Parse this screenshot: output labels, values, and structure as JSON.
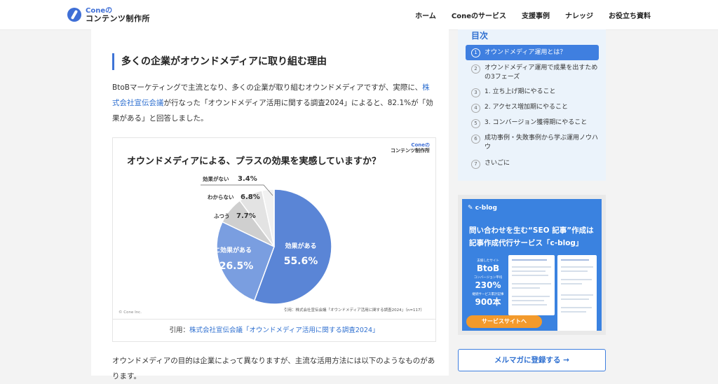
{
  "header": {
    "logo_top": "Coneの",
    "logo_bottom": "コンテンツ制作所",
    "nav": [
      "ホーム",
      "Coneのサービス",
      "支援事例",
      "ナレッジ",
      "お役立ち資料"
    ]
  },
  "article": {
    "heading": "多くの企業がオウンドメディアに取り組む理由",
    "intro_1": "BtoBマーケティングで主流となり、多くの企業が取り組むオウンドメディアですが、実際に、",
    "intro_link": "株式会社宣伝会議",
    "intro_2": "が行なった「オウンドメディア活用に関する調査2024」によると、82.1%が「効果がある」と回答しました。",
    "figure": {
      "logo_top": "Coneの",
      "logo_bottom": "コンテンツ制作所",
      "source": "引用：株式会社宣伝会議「オウンドメディア活用に関する調査2024」（n=117）",
      "copyright": "© Cone Inc."
    },
    "caption_prefix": "引用：",
    "caption_link": "株式会社宣伝会議「オウンドメディア活用に関する調査2024」",
    "outro": "オウンドメディアの目的は企業によって異なりますが、主流な活用方法には以下のようなものがあります。"
  },
  "chart_data": {
    "type": "pie",
    "title": "オウンドメディアによる、プラスの効果を実感していますか？",
    "slices": [
      {
        "label": "効果がある",
        "value": 55.6,
        "display": "55.6%",
        "color": "#5a85d6"
      },
      {
        "label": "非常に効果がある",
        "value": 26.5,
        "display": "26.5%",
        "color": "#7a9ee0"
      },
      {
        "label": "ふつう",
        "value": 7.7,
        "display": "7.7%",
        "color": "#cfcfcf"
      },
      {
        "label": "わからない",
        "value": 6.8,
        "display": "6.8%",
        "color": "#e3e3e3"
      },
      {
        "label": "効果がない",
        "value": 3.4,
        "display": "3.4%",
        "color": "#f1f1f1"
      }
    ]
  },
  "toc": {
    "title": "目次",
    "items": [
      {
        "num": "1",
        "text": "オウンドメディア運用とは？"
      },
      {
        "num": "2",
        "text": "オウンドメディア運用で成果を出すための3フェーズ"
      },
      {
        "num": "3",
        "text": "1. 立ち上げ期にやること"
      },
      {
        "num": "4",
        "text": "2. アクセス増加期にやること"
      },
      {
        "num": "5",
        "text": "3. コンバージョン獲得期にやること"
      },
      {
        "num": "6",
        "text": "成功事例・失敗事例から学ぶ運用ノウハウ"
      },
      {
        "num": "7",
        "text": "さいごに"
      }
    ]
  },
  "banner": {
    "brand": "c-blog",
    "title_1": "問い合わせを生む“SEO 記事”作成は",
    "title_2": "記事作成代行サービス「c-blog」",
    "stats": [
      {
        "label": "支援したサイト",
        "value": "BtoB"
      },
      {
        "label": "コンバージョン平均",
        "value": "230%"
      },
      {
        "label": "継続サービス累計記事",
        "value": "900本"
      }
    ],
    "button": "サービスサイトへ"
  },
  "mail_button": "メルマガに登録する →"
}
